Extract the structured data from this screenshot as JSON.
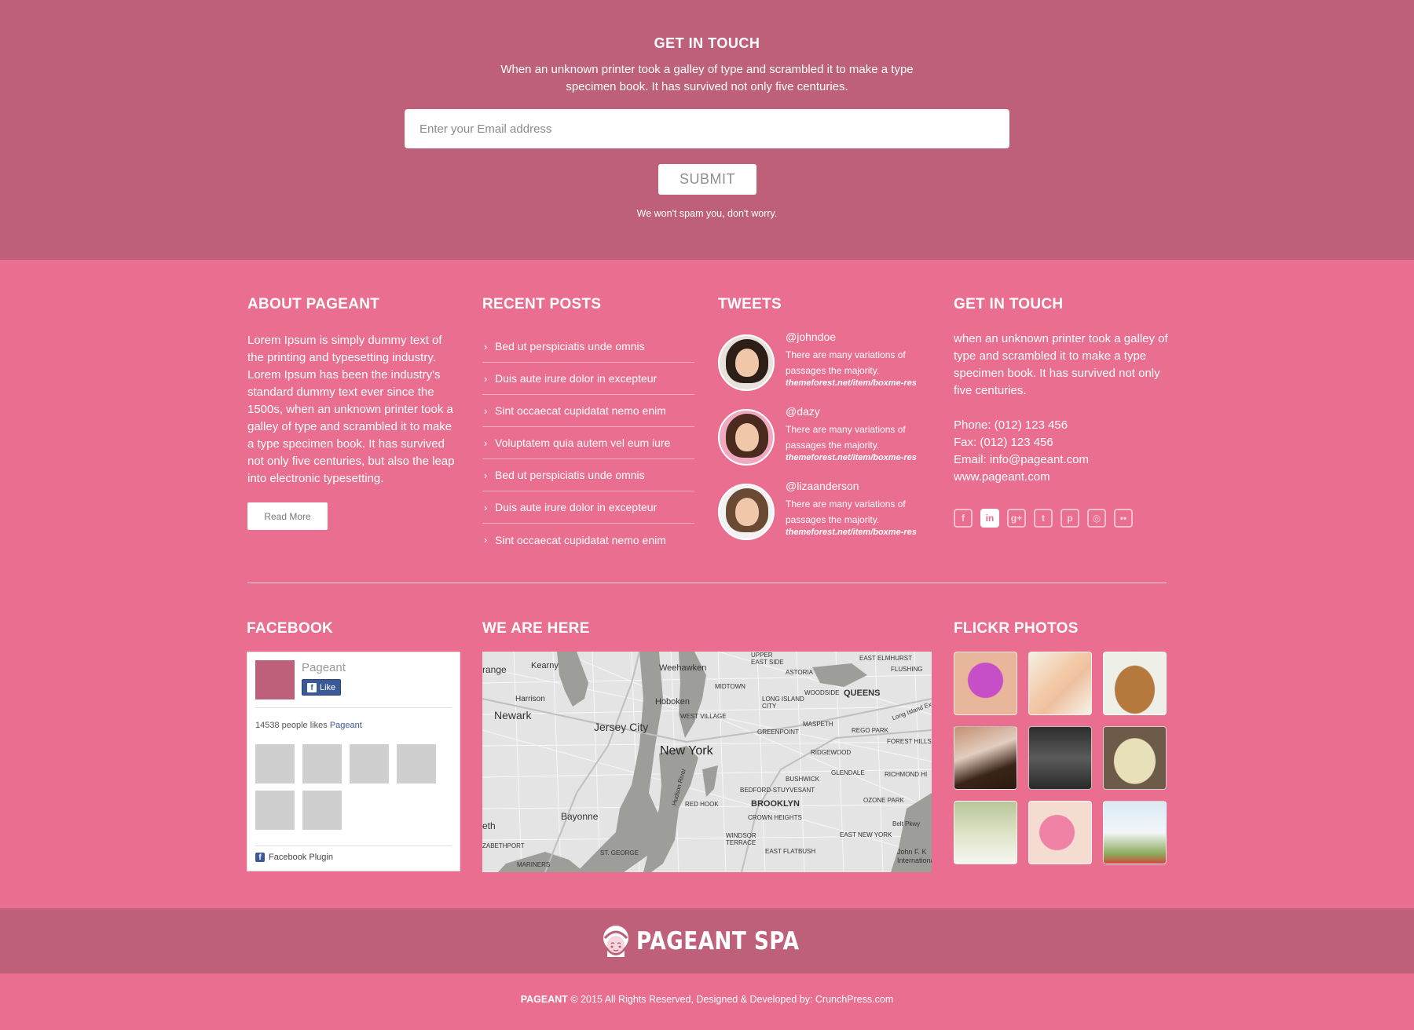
{
  "newsletter": {
    "title": "GET IN TOUCH",
    "text": "When an unknown printer took a galley of type and scrambled it to make a type specimen book. It has survived not only five centuries.",
    "email_placeholder": "Enter your Email address",
    "submit_label": "SUBMIT",
    "note": "We won't spam you, don't worry."
  },
  "about": {
    "title": "ABOUT PAGEANT",
    "text": "Lorem Ipsum is simply dummy text of the printing and typesetting industry. Lorem Ipsum has been the industry's standard dummy text ever since the 1500s, when an unknown printer took a galley of type and scrambled it to make a type specimen book. It has survived not only five centuries, but also the leap into electronic typesetting.",
    "read_more_label": "Read More"
  },
  "posts": {
    "title": "RECENT POSTS",
    "items": [
      "Bed ut perspiciatis unde omnis",
      "Duis aute irure dolor in excepteur",
      "Sint occaecat cupidatat nemo enim",
      "Voluptatem quia autem vel eum iure",
      "Bed ut perspiciatis unde omnis",
      "Duis aute irure dolor in excepteur",
      "Sint occaecat cupidatat nemo enim"
    ]
  },
  "tweets": {
    "title": "TWEETS",
    "items": [
      {
        "user": "@johndoe",
        "text": "There are many variations of passages the majority.",
        "link": "themeforest.net/item/boxme-res"
      },
      {
        "user": "@dazy",
        "text": "There are many variations of passages the majority.",
        "link": "themeforest.net/item/boxme-res"
      },
      {
        "user": "@lizaanderson",
        "text": "There are many variations of passages the majority.",
        "link": "themeforest.net/item/boxme-res"
      }
    ]
  },
  "contact": {
    "title": "GET IN TOUCH",
    "text": "when an unknown printer took a galley of type and scrambled it to make a type specimen book. It has survived not only five centuries.",
    "phone": "Phone: (012) 123 456",
    "fax": "Fax: (012) 123 456",
    "email": "Email: info@pageant.com",
    "website": "www.pageant.com",
    "socials": [
      "facebook-icon",
      "linkedin-icon",
      "google-plus-icon",
      "twitter-icon",
      "pinterest-icon",
      "instagram-icon",
      "flickr-icon"
    ]
  },
  "facebook": {
    "title": "FACEBOOK",
    "page_name": "Pageant",
    "like_label": "Like",
    "likes_text": "14538 people likes",
    "likes_link": "Pageant",
    "plugin_label": "Facebook Plugin"
  },
  "map": {
    "title": "WE ARE HERE",
    "labels": [
      "New York",
      "Jersey City",
      "Newark",
      "Hoboken",
      "Weehawken",
      "Kearny",
      "Harrison",
      "Bayonne",
      "QUEENS",
      "BROOKLYN",
      "MIDTOWN",
      "WEST VILLAGE",
      "GREENPOINT",
      "RIDGEWOOD",
      "ASTORIA",
      "WOODSIDE",
      "MASPETH",
      "BUSHWICK",
      "BEDFORD-STUYVESANT",
      "RED HOOK",
      "CROWN HEIGHTS",
      "GLENDALE",
      "OZONE PARK",
      "EAST NEW YORK",
      "EAST FLATBUSH",
      "WINDSOR TERRACE",
      "ST. GEORGE",
      "MARINERS",
      "FOREST HILLS",
      "REGO PARK",
      "FLUSHING",
      "RICHMOND HI",
      "UPPER EAST SIDE",
      "EAST ELMHURST",
      "LONG ISLAND CITY",
      "Hudson River",
      "Long Island Expy",
      "Belt Pkwy",
      "John F. K International",
      "range",
      "eth",
      "ZABETHPORT"
    ]
  },
  "flickr": {
    "title": "FLICKR PHOTOS"
  },
  "brand": {
    "name": "PAGEANT SPA"
  },
  "footer": {
    "brand": "PAGEANT",
    "copyright": "© 2015 All Rights Reserved, Designed & Developed by: CrunchPress.com"
  },
  "colors": {
    "top_band": "#be6079",
    "main_bg": "#ea6e8f",
    "facebook_blue": "#3b5998"
  }
}
